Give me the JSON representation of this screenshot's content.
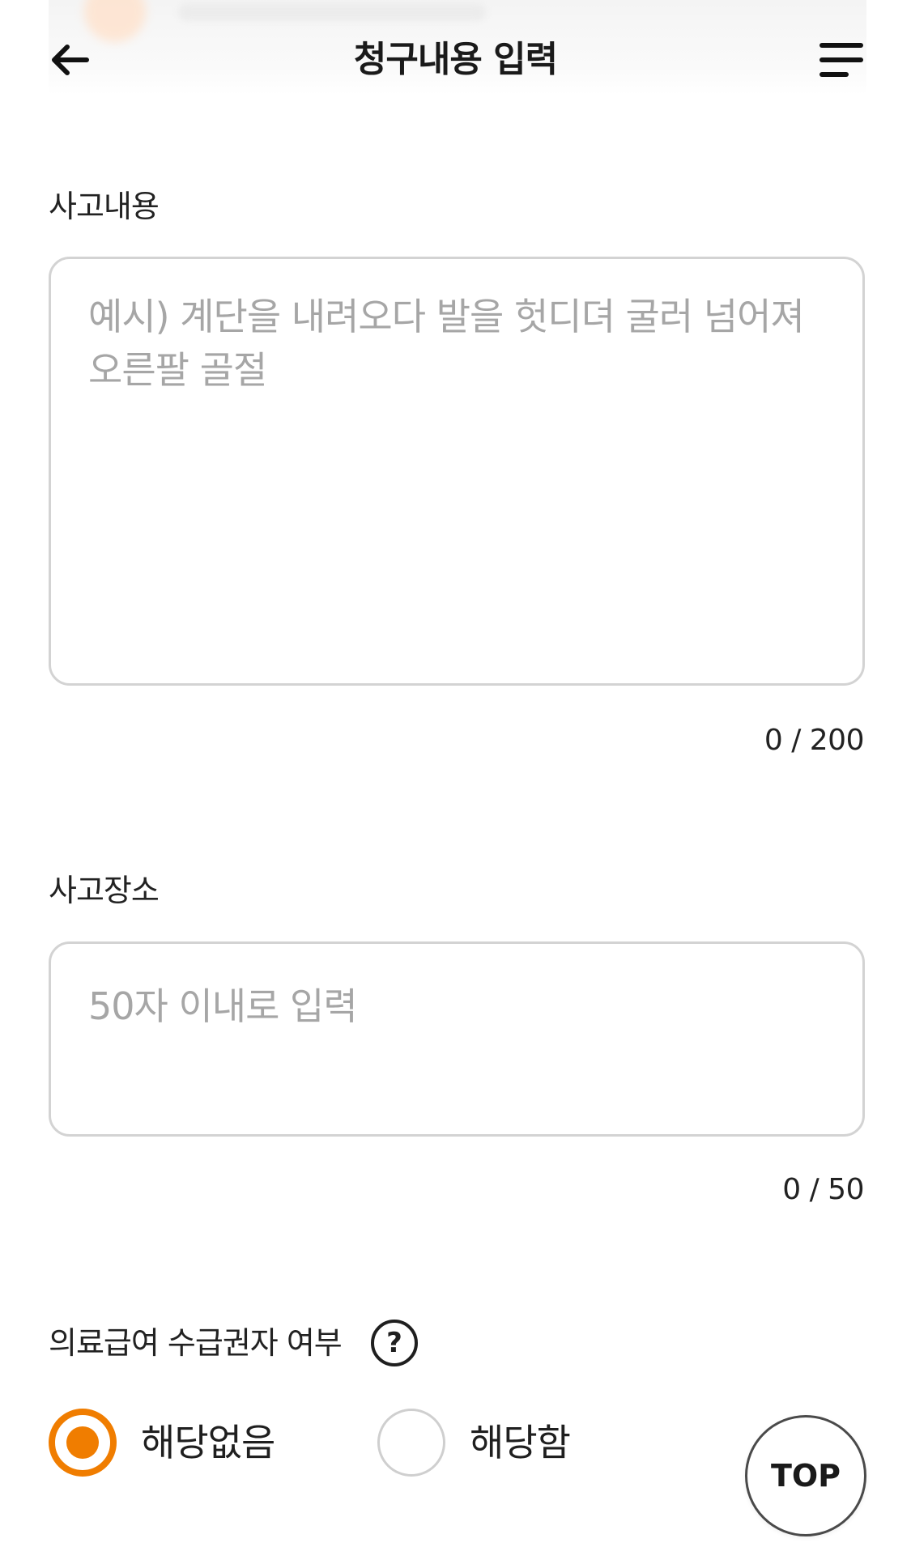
{
  "header": {
    "title": "청구내용 입력",
    "back_icon": "arrow-left-icon",
    "menu_icon": "hamburger-menu-icon"
  },
  "accident_description": {
    "label": "사고내용",
    "value": "",
    "placeholder": "예시) 계단을 내려오다 발을 헛디뎌 굴러 넘어져 오른팔 골절",
    "counter": "0 / 200"
  },
  "accident_location": {
    "label": "사고장소",
    "value": "",
    "placeholder": "50자 이내로 입력",
    "counter": "0 / 50"
  },
  "medical_aid": {
    "label": "의료급여 수급권자 여부",
    "help_glyph": "?",
    "options": [
      {
        "label": "해당없음",
        "selected": true
      },
      {
        "label": "해당함",
        "selected": false
      }
    ]
  },
  "top_button": {
    "label": "TOP"
  },
  "colors": {
    "accent": "#f07d00",
    "border": "#d3d3d3",
    "placeholder": "#a6a6a6",
    "text": "#1f1f1f"
  }
}
